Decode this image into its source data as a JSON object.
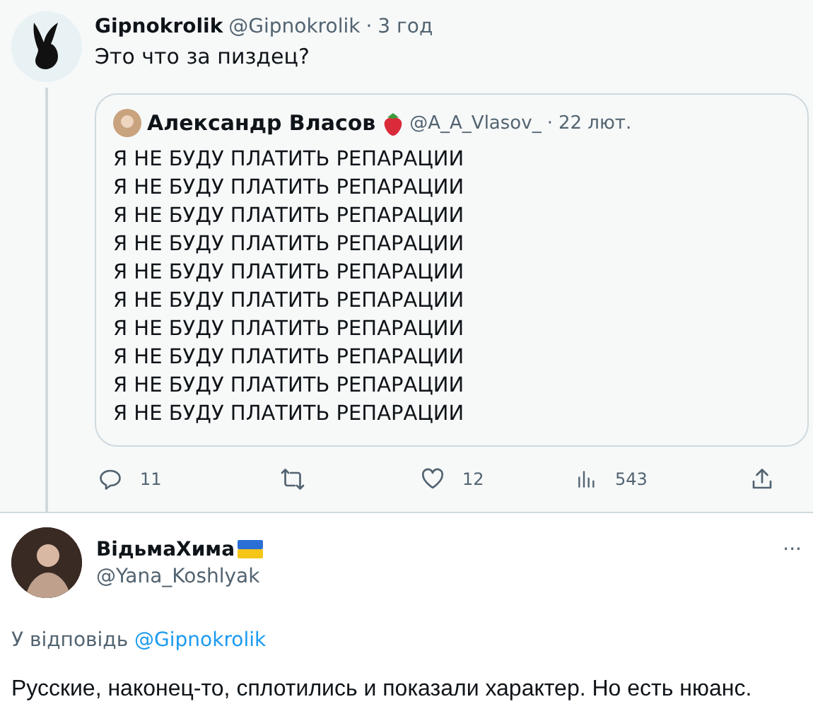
{
  "tweet": {
    "name": "Gipnokrolik",
    "handle": "@Gipnokrolik",
    "separator": "·",
    "time": "3 год",
    "text": "Это что за пиздец?",
    "quote": {
      "name": "Александр Власов",
      "handle": "@A_A_Vlasov_",
      "separator": "·",
      "time": "22 лют.",
      "lines": [
        "Я НЕ БУДУ ПЛАТИТЬ РЕПАРАЦИИ",
        "Я НЕ БУДУ ПЛАТИТЬ РЕПАРАЦИИ",
        "Я НЕ БУДУ ПЛАТИТЬ РЕПАРАЦИИ",
        "Я НЕ БУДУ ПЛАТИТЬ РЕПАРАЦИИ",
        "Я НЕ БУДУ ПЛАТИТЬ РЕПАРАЦИИ",
        "Я НЕ БУДУ ПЛАТИТЬ РЕПАРАЦИИ",
        "Я НЕ БУДУ ПЛАТИТЬ РЕПАРАЦИИ",
        "Я НЕ БУДУ ПЛАТИТЬ РЕПАРАЦИИ",
        "Я НЕ БУДУ ПЛАТИТЬ РЕПАРАЦИИ",
        "Я НЕ БУДУ ПЛАТИТЬ РЕПАРАЦИИ"
      ]
    },
    "actions": [
      {
        "kind": "reply",
        "count": "11"
      },
      {
        "kind": "retweet"
      },
      {
        "kind": "like",
        "count": "12"
      },
      {
        "kind": "views",
        "count": "543"
      },
      {
        "kind": "share"
      }
    ]
  },
  "reply": {
    "name": "ВідьмаХима",
    "handle": "@Yana_Koshlyak",
    "more": "···",
    "reply_to_label": "У відповідь",
    "reply_to_handle": "@Gipnokrolik",
    "text": "Русские, наконец-то, сплотились и показали характер. Но есть нюанс."
  }
}
